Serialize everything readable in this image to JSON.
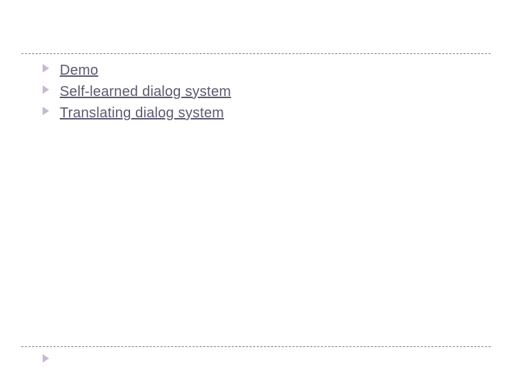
{
  "slide": {
    "items": [
      {
        "label": "Demo"
      },
      {
        "label": "Self-learned dialog system"
      },
      {
        "label": "Translating dialog system"
      }
    ]
  },
  "colors": {
    "bullet": "#c8b8d0",
    "text": "#5c5870",
    "dash": "#808080"
  }
}
